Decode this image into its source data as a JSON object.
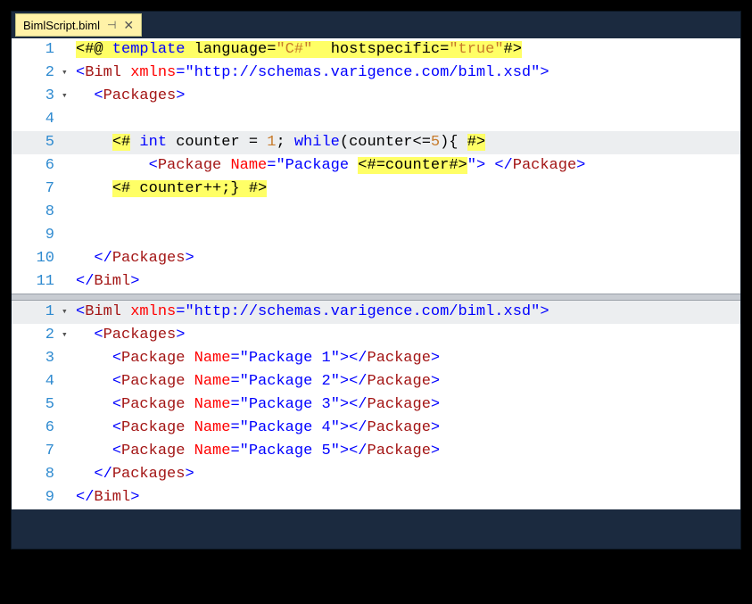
{
  "tab": {
    "filename": "BimlScript.biml",
    "pin_glyph": "⊣",
    "close_glyph": "✕"
  },
  "pane1": {
    "lines": [
      {
        "n": "1",
        "fold": ""
      },
      {
        "n": "2",
        "fold": "▾"
      },
      {
        "n": "3",
        "fold": "▾"
      },
      {
        "n": "4",
        "fold": ""
      },
      {
        "n": "5",
        "fold": ""
      },
      {
        "n": "6",
        "fold": ""
      },
      {
        "n": "7",
        "fold": ""
      },
      {
        "n": "8",
        "fold": ""
      },
      {
        "n": "9",
        "fold": ""
      },
      {
        "n": "10",
        "fold": ""
      },
      {
        "n": "11",
        "fold": ""
      }
    ],
    "l1": {
      "open": "<#@",
      "template": " template ",
      "lang_attr": "language",
      "eq1": "=",
      "lang_val": "\"C#\"",
      "sp": "  ",
      "host_attr": "hostspecific",
      "eq2": "=",
      "host_val": "\"true\"",
      "close": "#>"
    },
    "l2": {
      "lt": "<",
      "tag": "Biml",
      "sp": " ",
      "attr": "xmlns",
      "eq": "=",
      "val": "\"http://schemas.varigence.com/biml.xsd\"",
      "gt": ">"
    },
    "l3": {
      "lt": "<",
      "tag": "Packages",
      "gt": ">"
    },
    "l5": {
      "open": "<#",
      "sp1": " ",
      "int": "int",
      "sp2": " counter = ",
      "num1": "1",
      "rest": "; ",
      "while": "while",
      "paren": "(counter<=",
      "num5": "5",
      "end": "){ ",
      "close": "#>"
    },
    "l6": {
      "lt": "<",
      "tag": "Package",
      "sp": " ",
      "attr": "Name",
      "eq": "=",
      "q1": "\"Package ",
      "expr_open": "<#=",
      "expr": "counter",
      "expr_close": "#>",
      "q2": "\"",
      "gt": ">",
      "sp2": " ",
      "lt2": "</",
      "tag2": "Package",
      "gt2": ">"
    },
    "l7": {
      "open": "<#",
      "body": " counter++;} ",
      "close": "#>"
    },
    "l10": {
      "lt": "</",
      "tag": "Packages",
      "gt": ">"
    },
    "l11": {
      "lt": "</",
      "tag": "Biml",
      "gt": ">"
    }
  },
  "pane2": {
    "lines": [
      {
        "n": "1",
        "fold": "▾"
      },
      {
        "n": "2",
        "fold": "▾"
      },
      {
        "n": "3",
        "fold": ""
      },
      {
        "n": "4",
        "fold": ""
      },
      {
        "n": "5",
        "fold": ""
      },
      {
        "n": "6",
        "fold": ""
      },
      {
        "n": "7",
        "fold": ""
      },
      {
        "n": "8",
        "fold": ""
      },
      {
        "n": "9",
        "fold": ""
      }
    ],
    "l1": {
      "lt": "<",
      "tag": "Biml",
      "sp": " ",
      "attr": "xmlns",
      "eq": "=",
      "val": "\"http://schemas.varigence.com/biml.xsd\"",
      "gt": ">"
    },
    "l2": {
      "lt": "<",
      "tag": "Packages",
      "gt": ">"
    },
    "pkg": {
      "lt": "<",
      "tag": "Package",
      "sp": " ",
      "attr": "Name",
      "eq": "=",
      "q": "\"",
      "prefix": "Package ",
      "gt": ">",
      "lt2": "</",
      "tag2": "Package",
      "gt2": ">",
      "vals": [
        "1",
        "2",
        "3",
        "4",
        "5"
      ]
    },
    "l8": {
      "lt": "</",
      "tag": "Packages",
      "gt": ">"
    },
    "l9": {
      "lt": "</",
      "tag": "Biml",
      "gt": ">"
    }
  }
}
